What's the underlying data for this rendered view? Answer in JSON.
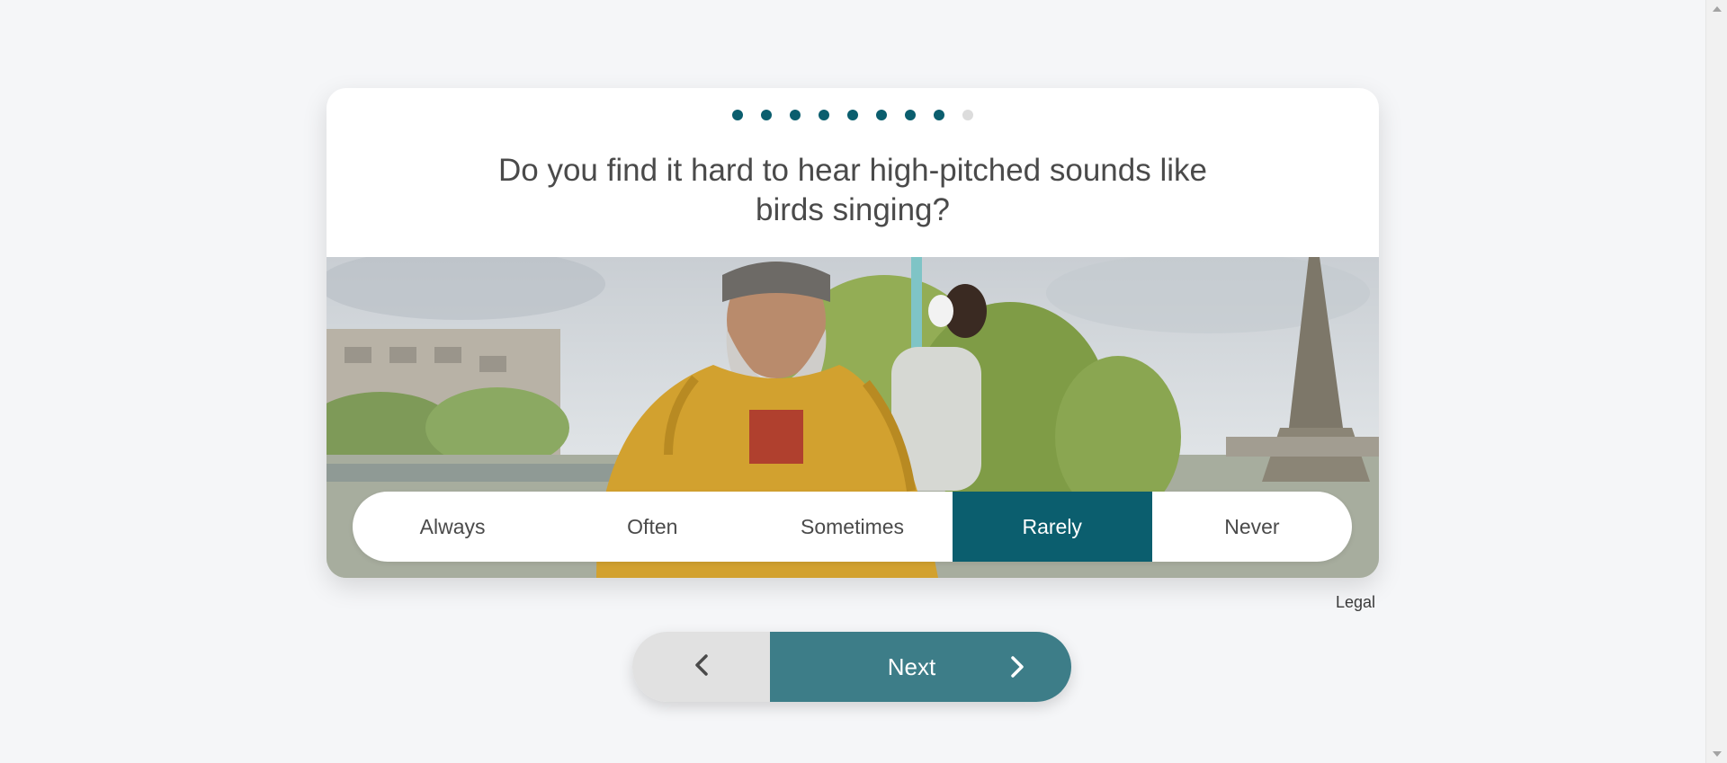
{
  "progress": {
    "total_steps": 9,
    "completed_steps": 8,
    "active_color": "#0b5e6e",
    "pending_color": "#dcdcdc"
  },
  "question": {
    "text": "Do you find it hard to hear high-pitched sounds like birds singing?"
  },
  "answers": {
    "options": [
      "Always",
      "Often",
      "Sometimes",
      "Rarely",
      "Never"
    ],
    "selected": "Rarely",
    "selected_color": "#0b5e6e"
  },
  "footer": {
    "legal_label": "Legal"
  },
  "navigation": {
    "back_icon": "chevron-left-icon",
    "next_label": "Next",
    "next_icon": "chevron-right-icon",
    "next_color": "#3d7d88"
  }
}
